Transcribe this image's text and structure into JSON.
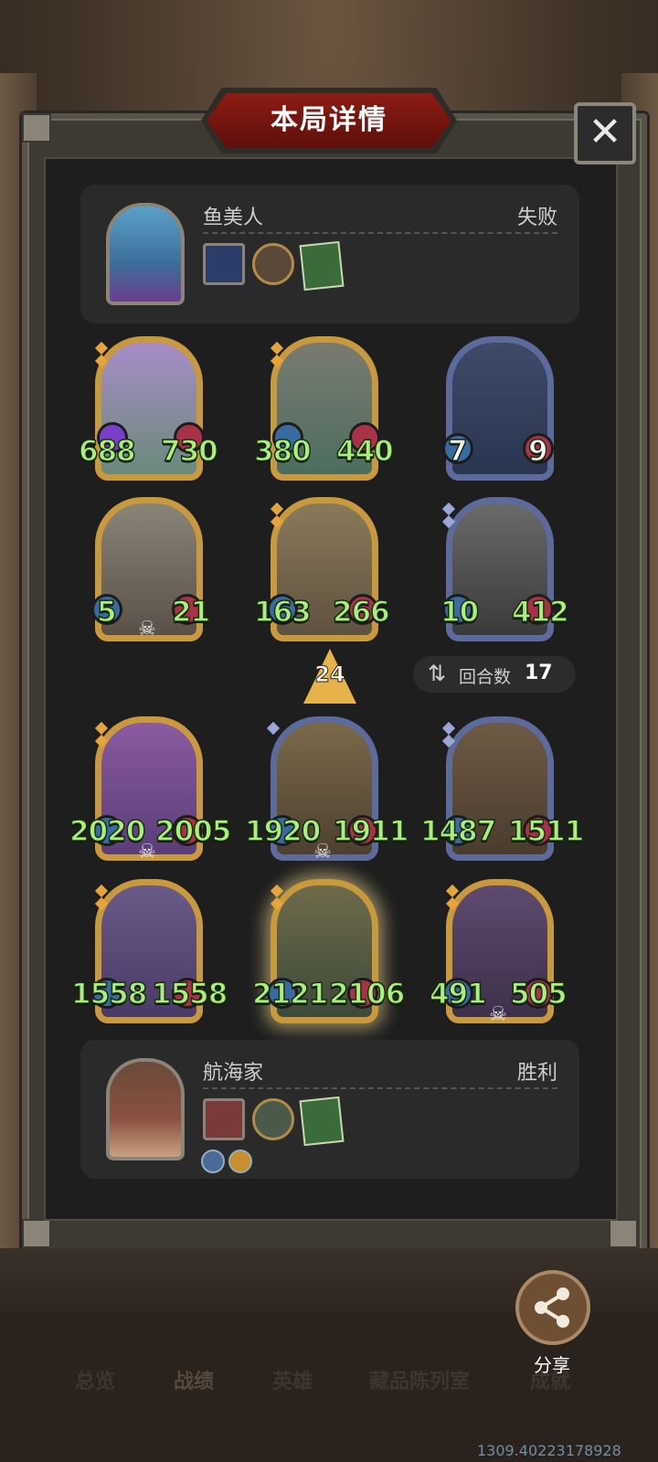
{
  "title": "本局详情",
  "close_label": "✕",
  "opponent": {
    "name": "鱼美人",
    "result": "失败"
  },
  "player": {
    "name": "航海家",
    "result": "胜利"
  },
  "turn": {
    "label": "回合数",
    "value": "17"
  },
  "level_indicator": "24",
  "opponent_cards": [
    {
      "attack": "688",
      "health": "730"
    },
    {
      "attack": "380",
      "health": "440"
    },
    {
      "attack": "7",
      "health": "9"
    },
    {
      "attack": "5",
      "health": "21"
    },
    {
      "attack": "163",
      "health": "266"
    },
    {
      "attack": "10",
      "health": "412"
    }
  ],
  "player_cards": [
    {
      "attack": "2020",
      "health": "2005"
    },
    {
      "attack": "1920",
      "health": "1911"
    },
    {
      "attack": "1487",
      "health": "1511"
    },
    {
      "attack": "1558",
      "health": "1558"
    },
    {
      "attack": "2121",
      "health": "2106"
    },
    {
      "attack": "491",
      "health": "505"
    }
  ],
  "share_label": "分享",
  "nav": [
    "总览",
    "战绩",
    "英雄",
    "藏品陈列室",
    "成就"
  ],
  "uid": "1309.40223178928",
  "colors": {
    "stat_green": "#a8f07a",
    "gold_frame": "#c99a3d",
    "blue_frame": "#5c6a9c",
    "title_red": "#8c1c14"
  },
  "icons": [
    "close-icon",
    "share-icon",
    "skull-icon",
    "swap-icon",
    "level-arrow-icon"
  ]
}
